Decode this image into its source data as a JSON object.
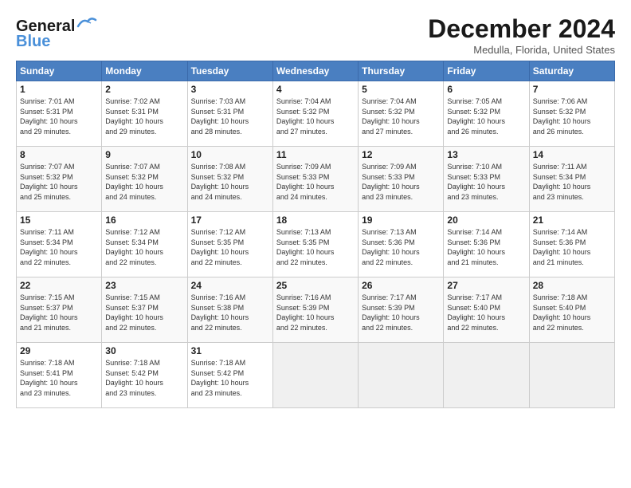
{
  "header": {
    "logo_general": "General",
    "logo_blue": "Blue",
    "month_title": "December 2024",
    "location": "Medulla, Florida, United States"
  },
  "days_of_week": [
    "Sunday",
    "Monday",
    "Tuesday",
    "Wednesday",
    "Thursday",
    "Friday",
    "Saturday"
  ],
  "weeks": [
    [
      {
        "day": "1",
        "info": "Sunrise: 7:01 AM\nSunset: 5:31 PM\nDaylight: 10 hours\nand 29 minutes."
      },
      {
        "day": "2",
        "info": "Sunrise: 7:02 AM\nSunset: 5:31 PM\nDaylight: 10 hours\nand 29 minutes."
      },
      {
        "day": "3",
        "info": "Sunrise: 7:03 AM\nSunset: 5:31 PM\nDaylight: 10 hours\nand 28 minutes."
      },
      {
        "day": "4",
        "info": "Sunrise: 7:04 AM\nSunset: 5:32 PM\nDaylight: 10 hours\nand 27 minutes."
      },
      {
        "day": "5",
        "info": "Sunrise: 7:04 AM\nSunset: 5:32 PM\nDaylight: 10 hours\nand 27 minutes."
      },
      {
        "day": "6",
        "info": "Sunrise: 7:05 AM\nSunset: 5:32 PM\nDaylight: 10 hours\nand 26 minutes."
      },
      {
        "day": "7",
        "info": "Sunrise: 7:06 AM\nSunset: 5:32 PM\nDaylight: 10 hours\nand 26 minutes."
      }
    ],
    [
      {
        "day": "8",
        "info": "Sunrise: 7:07 AM\nSunset: 5:32 PM\nDaylight: 10 hours\nand 25 minutes."
      },
      {
        "day": "9",
        "info": "Sunrise: 7:07 AM\nSunset: 5:32 PM\nDaylight: 10 hours\nand 24 minutes."
      },
      {
        "day": "10",
        "info": "Sunrise: 7:08 AM\nSunset: 5:32 PM\nDaylight: 10 hours\nand 24 minutes."
      },
      {
        "day": "11",
        "info": "Sunrise: 7:09 AM\nSunset: 5:33 PM\nDaylight: 10 hours\nand 24 minutes."
      },
      {
        "day": "12",
        "info": "Sunrise: 7:09 AM\nSunset: 5:33 PM\nDaylight: 10 hours\nand 23 minutes."
      },
      {
        "day": "13",
        "info": "Sunrise: 7:10 AM\nSunset: 5:33 PM\nDaylight: 10 hours\nand 23 minutes."
      },
      {
        "day": "14",
        "info": "Sunrise: 7:11 AM\nSunset: 5:34 PM\nDaylight: 10 hours\nand 23 minutes."
      }
    ],
    [
      {
        "day": "15",
        "info": "Sunrise: 7:11 AM\nSunset: 5:34 PM\nDaylight: 10 hours\nand 22 minutes."
      },
      {
        "day": "16",
        "info": "Sunrise: 7:12 AM\nSunset: 5:34 PM\nDaylight: 10 hours\nand 22 minutes."
      },
      {
        "day": "17",
        "info": "Sunrise: 7:12 AM\nSunset: 5:35 PM\nDaylight: 10 hours\nand 22 minutes."
      },
      {
        "day": "18",
        "info": "Sunrise: 7:13 AM\nSunset: 5:35 PM\nDaylight: 10 hours\nand 22 minutes."
      },
      {
        "day": "19",
        "info": "Sunrise: 7:13 AM\nSunset: 5:36 PM\nDaylight: 10 hours\nand 22 minutes."
      },
      {
        "day": "20",
        "info": "Sunrise: 7:14 AM\nSunset: 5:36 PM\nDaylight: 10 hours\nand 21 minutes."
      },
      {
        "day": "21",
        "info": "Sunrise: 7:14 AM\nSunset: 5:36 PM\nDaylight: 10 hours\nand 21 minutes."
      }
    ],
    [
      {
        "day": "22",
        "info": "Sunrise: 7:15 AM\nSunset: 5:37 PM\nDaylight: 10 hours\nand 21 minutes."
      },
      {
        "day": "23",
        "info": "Sunrise: 7:15 AM\nSunset: 5:37 PM\nDaylight: 10 hours\nand 22 minutes."
      },
      {
        "day": "24",
        "info": "Sunrise: 7:16 AM\nSunset: 5:38 PM\nDaylight: 10 hours\nand 22 minutes."
      },
      {
        "day": "25",
        "info": "Sunrise: 7:16 AM\nSunset: 5:39 PM\nDaylight: 10 hours\nand 22 minutes."
      },
      {
        "day": "26",
        "info": "Sunrise: 7:17 AM\nSunset: 5:39 PM\nDaylight: 10 hours\nand 22 minutes."
      },
      {
        "day": "27",
        "info": "Sunrise: 7:17 AM\nSunset: 5:40 PM\nDaylight: 10 hours\nand 22 minutes."
      },
      {
        "day": "28",
        "info": "Sunrise: 7:18 AM\nSunset: 5:40 PM\nDaylight: 10 hours\nand 22 minutes."
      }
    ],
    [
      {
        "day": "29",
        "info": "Sunrise: 7:18 AM\nSunset: 5:41 PM\nDaylight: 10 hours\nand 23 minutes."
      },
      {
        "day": "30",
        "info": "Sunrise: 7:18 AM\nSunset: 5:42 PM\nDaylight: 10 hours\nand 23 minutes."
      },
      {
        "day": "31",
        "info": "Sunrise: 7:18 AM\nSunset: 5:42 PM\nDaylight: 10 hours\nand 23 minutes."
      },
      {
        "day": "",
        "info": ""
      },
      {
        "day": "",
        "info": ""
      },
      {
        "day": "",
        "info": ""
      },
      {
        "day": "",
        "info": ""
      }
    ]
  ]
}
